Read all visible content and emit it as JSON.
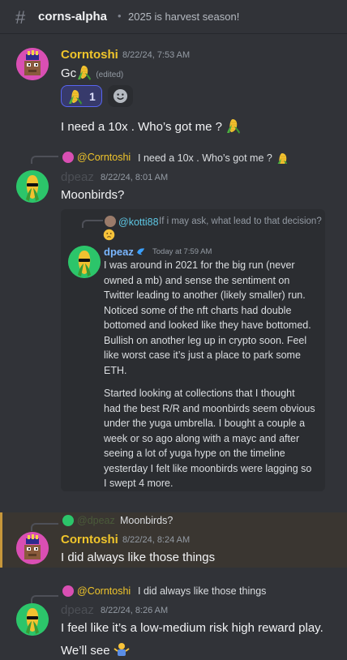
{
  "header": {
    "channel_name": "corns-alpha",
    "topic": "2025 is harvest season!"
  },
  "messages": [
    {
      "author": "Corntoshi",
      "timestamp": "8/22/24, 7:53 AM",
      "line1_text": "Gc",
      "edited": "(edited)",
      "reaction_count": "1",
      "line2_text": "I need a 10x . Who’s got me ?"
    },
    {
      "reply_author": "@Corntoshi",
      "reply_text": "I need a 10x . Who’s got me ?",
      "author": "dpeaz",
      "timestamp": "8/22/24, 8:01 AM",
      "text": "Moonbirds?"
    },
    {
      "reply_author": "@dpeaz",
      "reply_text": "Moonbirds?",
      "author": "Corntoshi",
      "timestamp": "8/22/24, 8:24 AM",
      "text": "I did always like those things"
    },
    {
      "reply_author": "@Corntoshi",
      "reply_text": "I did always like those things",
      "author": "dpeaz",
      "timestamp": "8/22/24, 8:26 AM",
      "line1": "I feel like it’s a low-medium risk high reward play.",
      "line2": "We’ll see"
    }
  ],
  "embed": {
    "reply_author": "@kotti88",
    "reply_text": "If i may ask, what lead to that decision?",
    "author": "dpeaz",
    "timestamp": "Today at 7:59 AM",
    "paragraph1": [
      "I was around in 2021 for the big run (never",
      "owned a mb) and sense the sentiment on",
      "Twitter leading to another (likely smaller) run.",
      "Noticed some of the nft charts had double",
      "bottomed and looked like they have bottomed.",
      "Bullish on another leg up in crypto soon. Feel",
      "like worst case it’s just a place to park some",
      "ETH."
    ],
    "paragraph2": [
      "Started looking at collections that I thought",
      "had the best R/R and moonbirds seem obvious",
      "under the yuga umbrella. I bought a couple a",
      "week or so ago along with a mayc and after",
      "seeing a lot of yuga hype on the timeline",
      "yesterday I felt like moonbirds were lagging so",
      "I swept 4 more."
    ]
  },
  "icons": {
    "corn": "corn-emoji-icon",
    "smile": "add-reaction-icon",
    "verified": "verified-bird-icon",
    "shrug": "person-shrugging-emoji-icon"
  },
  "colors": {
    "background": "#313338",
    "username_gold": "#f0c52b",
    "embed_author_blue": "#7ab6ff",
    "highlight_border": "#c7973a"
  }
}
